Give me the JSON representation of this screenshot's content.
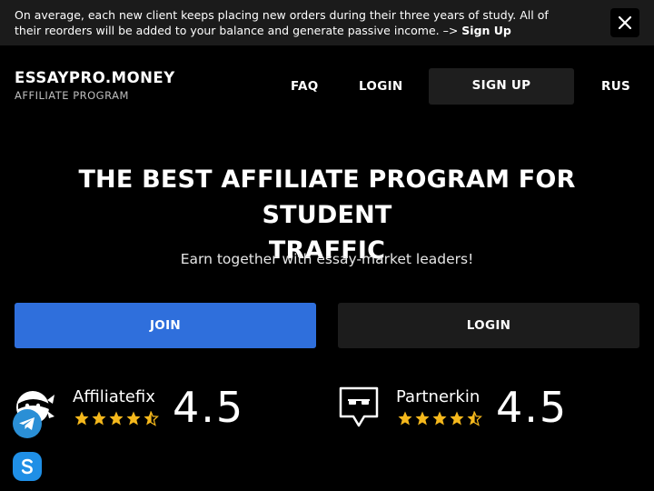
{
  "banner": {
    "text": "On average, each new client keeps placing new orders during their three years of study. All of their reorders will be added to your balance and generate passive income. –> ",
    "link": "Sign Up",
    "close_icon": "close-icon"
  },
  "header": {
    "logo": "ESSAYPRO.MONEY",
    "logo_sub": "AFFILIATE PROGRAM",
    "nav": {
      "faq": "FAQ",
      "login": "LOGIN",
      "signup": "SIGN UP",
      "lang": "RUS"
    }
  },
  "hero": {
    "title_line1": "THE BEST AFFILIATE PROGRAM FOR STUDENT",
    "title_line2": "TRAFFIC",
    "subtitle": "Earn together with essay-market leaders!",
    "join_label": "JOIN",
    "login_label": "LOGIN"
  },
  "ratings": [
    {
      "name": "Affiliatefix",
      "score": "4.5",
      "stars": 4.5,
      "icon": "affiliatefix-logo-icon"
    },
    {
      "name": "Partnerkin",
      "score": "4.5",
      "stars": 4.5,
      "icon": "partnerkin-logo-icon"
    }
  ],
  "social": {
    "telegram_icon": "telegram-icon",
    "skype_icon": "skype-icon"
  },
  "colors": {
    "accent": "#2f6fdc",
    "star": "#f5b81c",
    "banner_bg": "#1b1b1b",
    "page_bg": "#000000"
  }
}
